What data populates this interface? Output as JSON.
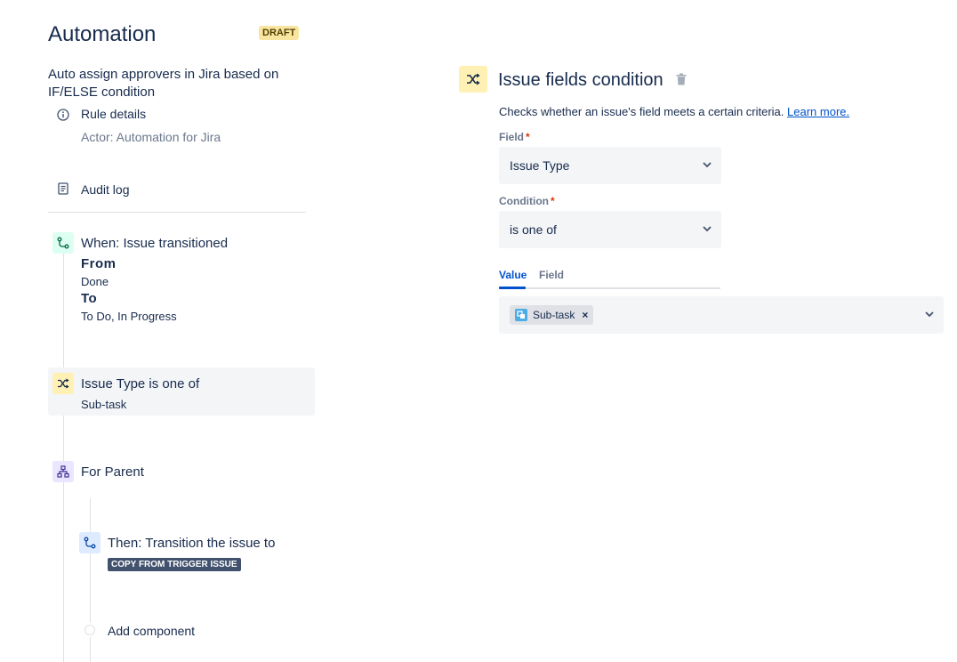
{
  "sidebar": {
    "title": "Automation",
    "draft_badge": "DRAFT",
    "rule_name": "Auto assign approvers in Jira based on IF/ELSE condition",
    "rule_details_label": "Rule details",
    "actor": "Actor: Automation for Jira",
    "audit_log_label": "Audit log",
    "trigger": {
      "title": "When: Issue transitioned",
      "from_label": "From",
      "from_value": "Done",
      "to_label": "To",
      "to_value": "To Do, In Progress"
    },
    "condition": {
      "title": "Issue Type is one of",
      "subtitle": "Sub-task"
    },
    "branch": {
      "title": "For Parent"
    },
    "action": {
      "title": "Then: Transition the issue to",
      "badge": "COPY FROM TRIGGER ISSUE"
    },
    "add_component_label": "Add component"
  },
  "panel": {
    "title": "Issue fields condition",
    "description": "Checks whether an issue's field meets a certain criteria.",
    "learn_more": "Learn more.",
    "field_label": "Field",
    "field_value": "Issue Type",
    "condition_label": "Condition",
    "condition_value": "is one of",
    "required_mark": "*",
    "tabs": [
      {
        "label": "Value",
        "active": true
      },
      {
        "label": "Field",
        "active": false
      }
    ],
    "selected_values": [
      {
        "label": "Sub-task",
        "remove": "×"
      }
    ]
  },
  "colors": {
    "primary": "#0052cc",
    "text": "#172b4d",
    "subtle": "#6b778c",
    "draft_bg": "#f8e6a0",
    "condition_yellow": "#fff0b3",
    "trigger_green": "#dcfff1",
    "branch_purple": "#eae6ff",
    "action_blue": "#deebff"
  }
}
